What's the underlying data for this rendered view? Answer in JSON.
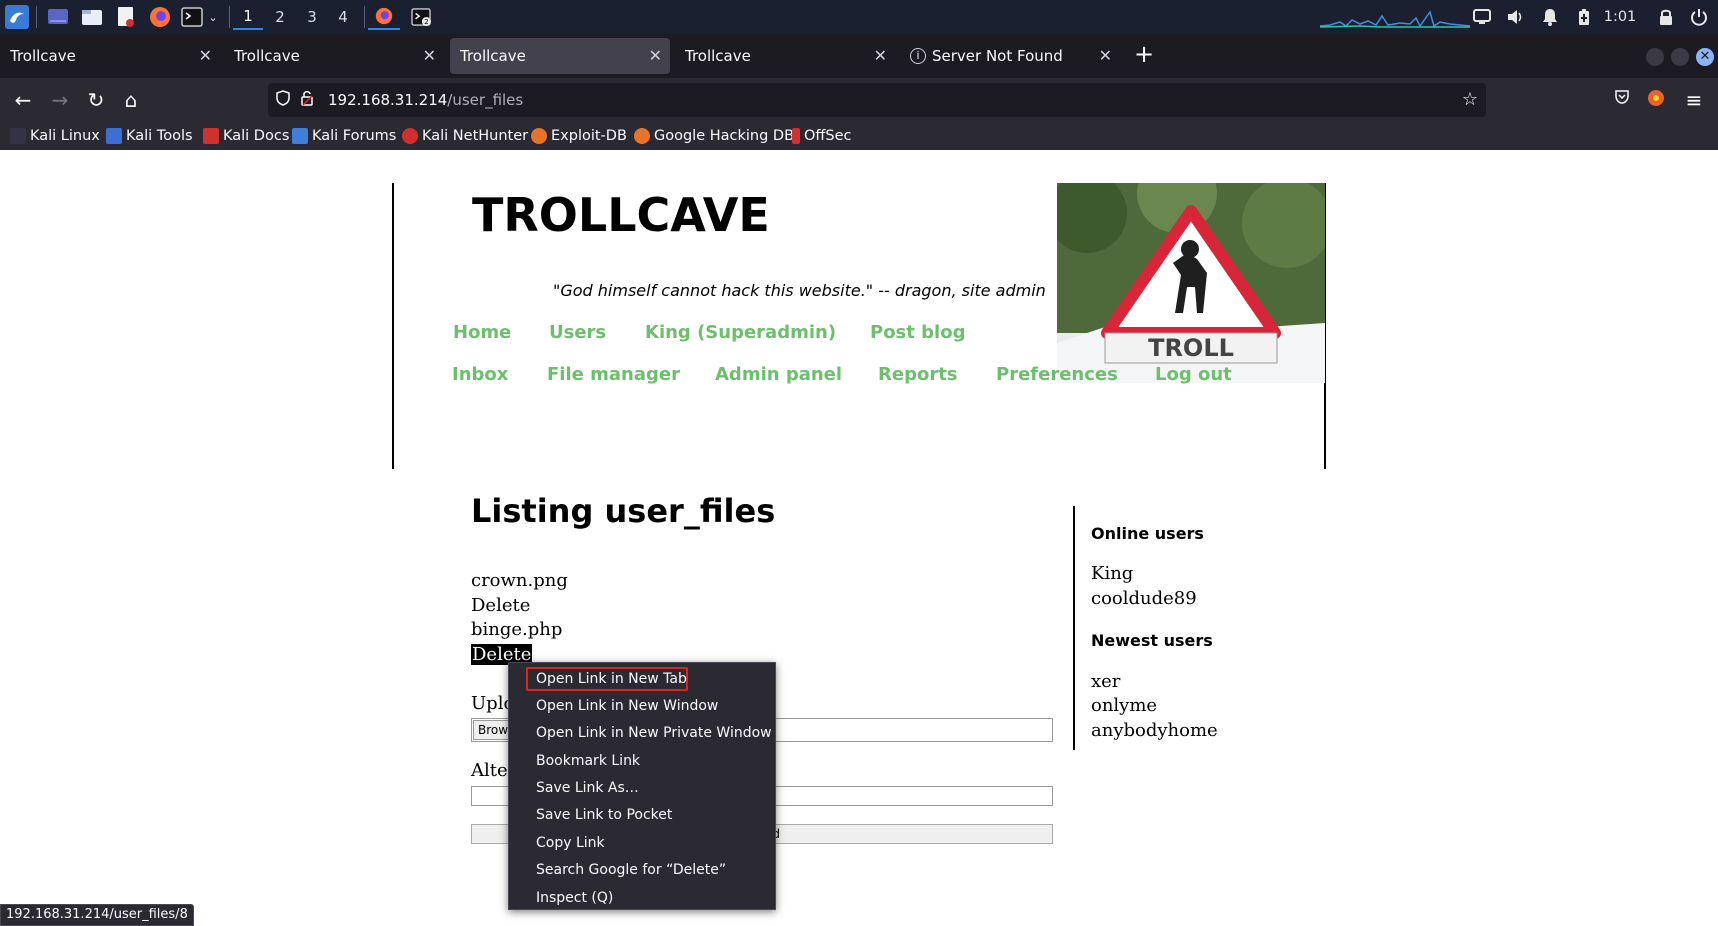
{
  "panel": {
    "workspaces": [
      "1",
      "2",
      "3",
      "4"
    ],
    "active_workspace": "1",
    "clock": "1:01",
    "icons": [
      "kali-menu-icon",
      "desktop-icon",
      "file-manager-icon",
      "text-editor-icon",
      "firefox-icon",
      "terminal-icon",
      "chevron-down-icon",
      "firefox-window-icon",
      "terminal-window-icon",
      "network-graph",
      "display-icon",
      "volume-icon",
      "notification-bell-icon",
      "battery-icon",
      "lock-icon",
      "power-icon"
    ]
  },
  "browser": {
    "tabs": [
      {
        "title": "Trollcave",
        "active": false
      },
      {
        "title": "Trollcave",
        "active": false
      },
      {
        "title": "Trollcave",
        "active": true
      },
      {
        "title": "Trollcave",
        "active": false
      },
      {
        "title": "Server Not Found",
        "active": false
      }
    ],
    "url_host": "192.168.31.214",
    "url_path": "/user_files",
    "bookmarks": [
      "Kali Linux",
      "Kali Tools",
      "Kali Docs",
      "Kali Forums",
      "Kali NetHunter",
      "Exploit-DB",
      "Google Hacking DB",
      "OffSec"
    ],
    "status_url": "192.168.31.214/user_files/8"
  },
  "site": {
    "title": "TROLLCAVE",
    "tagline": "\"God himself cannot hack this website.\" -- dragon, site admin",
    "image_text": "TROLL",
    "nav_row1": [
      "Home",
      "Users",
      "King (Superadmin)",
      "Post blog"
    ],
    "nav_row2": [
      "Inbox",
      "File manager",
      "Admin panel",
      "Reports",
      "Preferences",
      "Log out"
    ]
  },
  "main": {
    "heading": "Listing user_files",
    "files": [
      {
        "name": "crown.png",
        "action": "Delete"
      },
      {
        "name": "binge.php",
        "action": "Delete"
      }
    ],
    "upload_label_visible": "Uplo",
    "browse_visible": "Brow",
    "alt_label_visible": "Alte",
    "submit_visible": "d"
  },
  "sidebar": {
    "online_heading": "Online users",
    "online_users": [
      "King",
      "cooldude89"
    ],
    "newest_heading": "Newest users",
    "newest_users": [
      "xer",
      "onlyme",
      "anybodyhome"
    ]
  },
  "context_menu": {
    "items": [
      "Open Link in New Tab",
      "Open Link in New Window",
      "Open Link in New Private Window",
      "Bookmark Link",
      "Save Link As…",
      "Save Link to Pocket",
      "Copy Link",
      "Search Google for “Delete”",
      "Inspect (Q)"
    ],
    "highlighted_item": "Open Link in New Tab",
    "highlight_color": "#e0241b"
  },
  "colors": {
    "nav_link": "#6cc06c",
    "panel_bg": "#1b2030",
    "browser_bg": "#2b2a33"
  }
}
